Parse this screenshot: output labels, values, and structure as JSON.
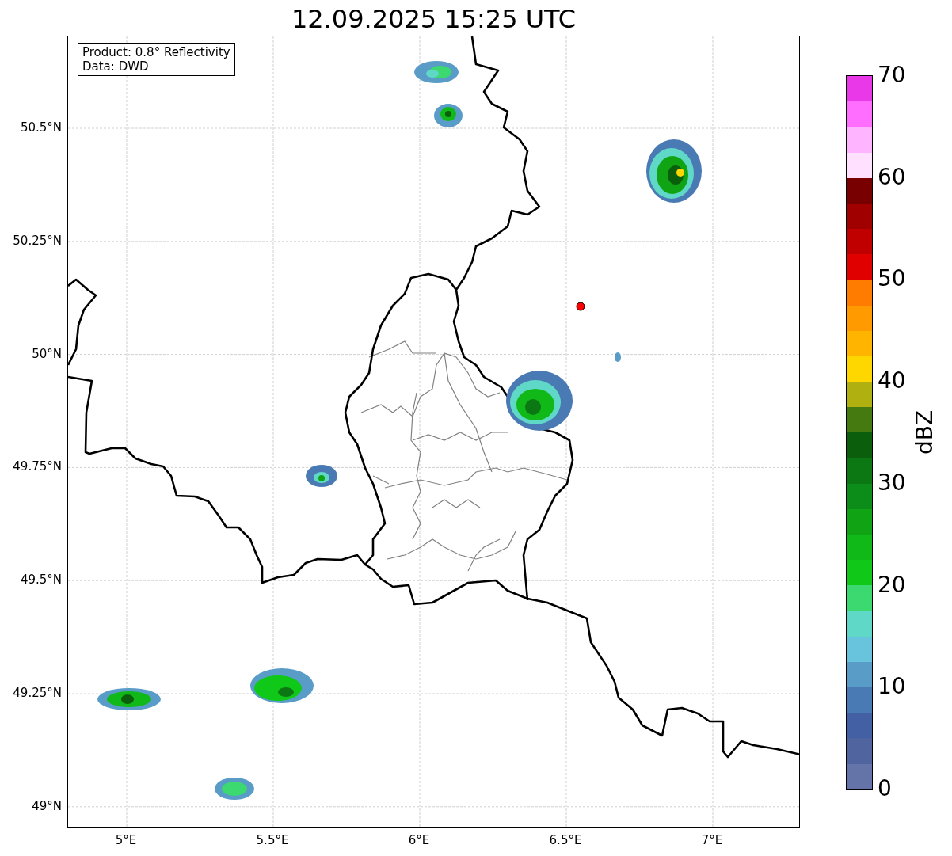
{
  "title": "12.09.2025 15:25 UTC",
  "map": {
    "info_box": [
      "Product: 0.8° Reflectivity",
      "Data: DWD"
    ],
    "x_ticks": [
      "5°E",
      "5.5°E",
      "6°E",
      "6.5°E",
      "7°E"
    ],
    "y_ticks": [
      "50.5°N",
      "50.25°N",
      "50°N",
      "49.75°N",
      "49.5°N",
      "49.25°N",
      "49°N"
    ]
  },
  "colorbar": {
    "label": "dBZ",
    "ticks": [
      "70",
      "60",
      "50",
      "40",
      "30",
      "20",
      "10",
      "0"
    ],
    "segments": [
      {
        "color": "#e838e8"
      },
      {
        "color": "#ff6eff"
      },
      {
        "color": "#ffb4ff"
      },
      {
        "color": "#ffe0ff"
      },
      {
        "color": "#780000"
      },
      {
        "color": "#a00000"
      },
      {
        "color": "#c00000"
      },
      {
        "color": "#e00000"
      },
      {
        "color": "#ff7c00"
      },
      {
        "color": "#ff9a00"
      },
      {
        "color": "#ffb400"
      },
      {
        "color": "#ffd700"
      },
      {
        "color": "#b0b010"
      },
      {
        "color": "#447a10"
      },
      {
        "color": "#0a5e0c"
      },
      {
        "color": "#0c7814"
      },
      {
        "color": "#0c8c18"
      },
      {
        "color": "#10a414"
      },
      {
        "color": "#10b818"
      },
      {
        "color": "#10c818"
      },
      {
        "color": "#3cd870"
      },
      {
        "color": "#60d8c8"
      },
      {
        "color": "#68c4dc"
      },
      {
        "color": "#5a9cc8"
      },
      {
        "color": "#4a7ab4"
      },
      {
        "color": "#4360a4"
      },
      {
        "color": "#5065a0"
      },
      {
        "color": "#6574a8"
      }
    ]
  }
}
